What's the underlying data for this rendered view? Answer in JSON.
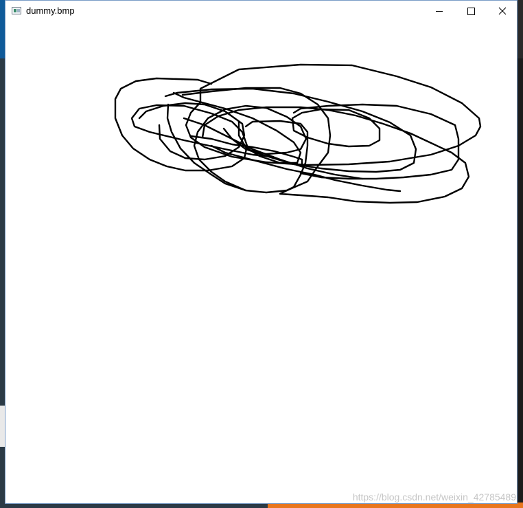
{
  "window": {
    "title": "dummy.bmp"
  },
  "controls": {
    "minimize": "minimize-icon",
    "maximize": "maximize-icon",
    "close": "close-icon"
  },
  "canvas": {
    "stroke_color": "#000000",
    "background": "#ffffff"
  },
  "watermark": {
    "text": "https://blog.csdn.net/weixin_42785489"
  }
}
